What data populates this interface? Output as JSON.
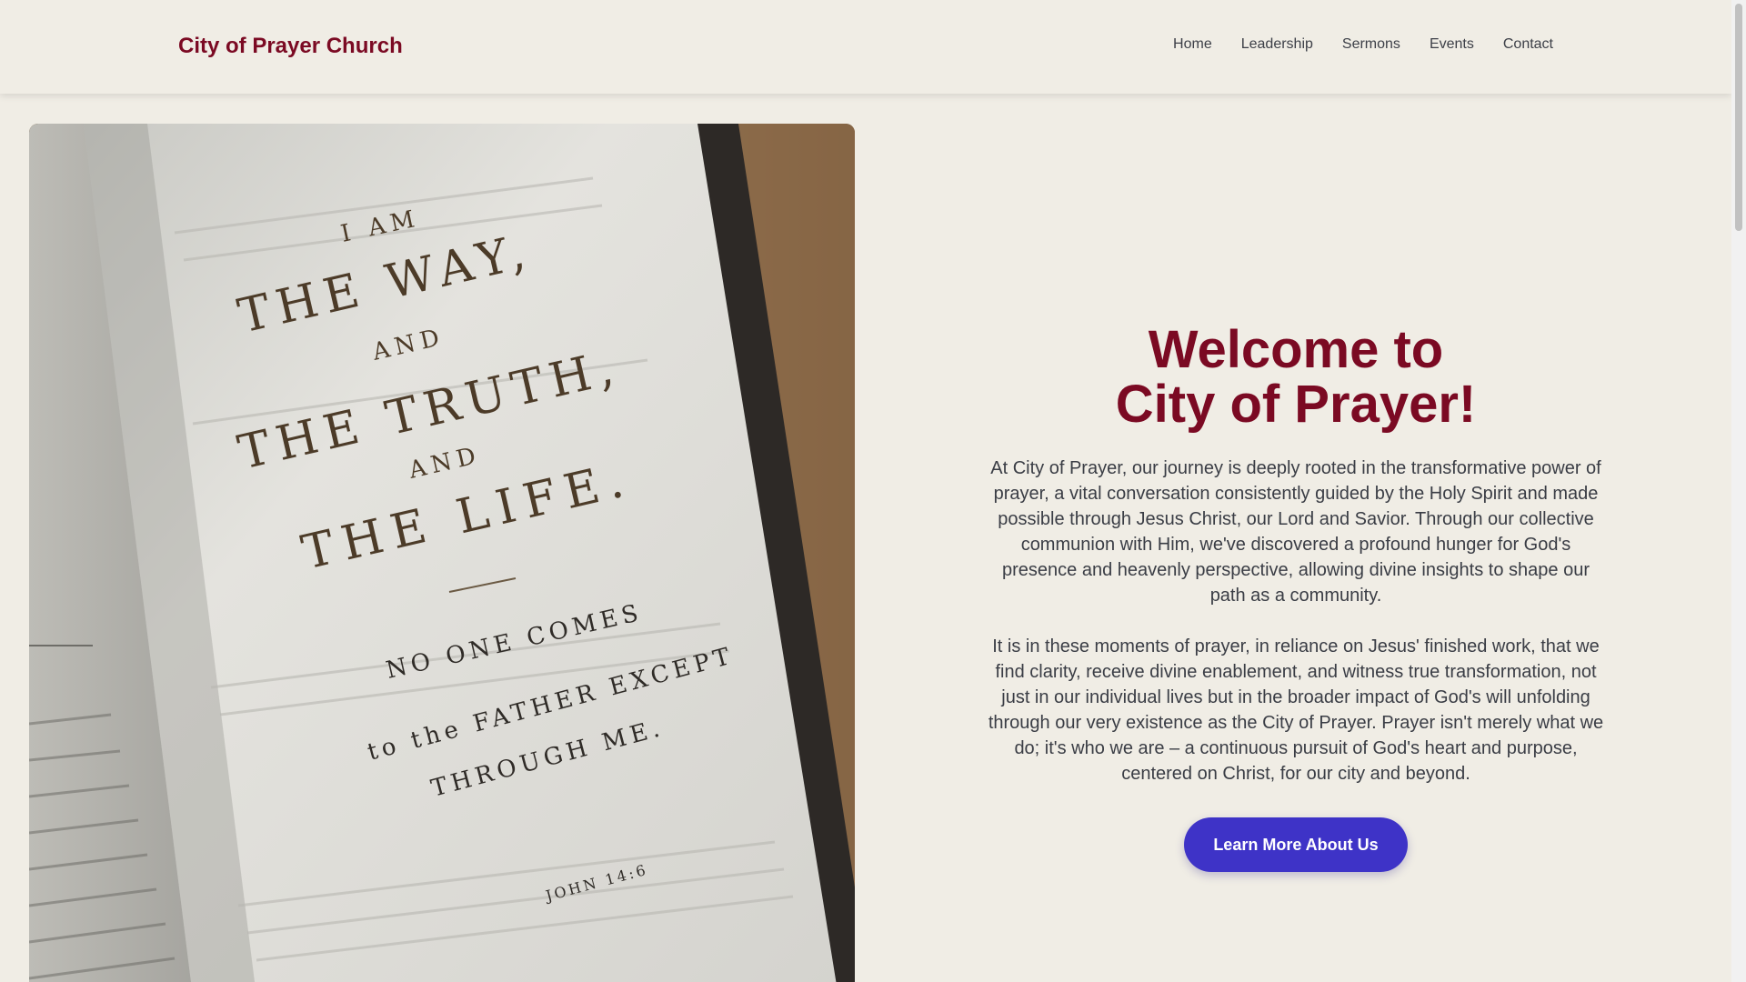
{
  "header": {
    "logo": "City of Prayer Church",
    "nav": [
      "Home",
      "Leadership",
      "Sermons",
      "Events",
      "Contact"
    ]
  },
  "hero_image": {
    "verse": {
      "line1": "I AM",
      "line2": "THE WAY,",
      "line3": "AND",
      "line4": "THE TRUTH,",
      "line5": "AND",
      "line6": "THE LIFE.",
      "line7": "NO ONE COMES",
      "line8": "to the FATHER EXCEPT",
      "line9": "THROUGH ME.",
      "reference": "JOHN 14:6"
    }
  },
  "main": {
    "title_line1": "Welcome to",
    "title_line2": "City of Prayer!",
    "paragraph1": "At City of Prayer, our journey is deeply rooted in the transformative power of prayer, a vital conversation consistently guided by the Holy Spirit and made possible through Jesus Christ, our Lord and Savior. Through our collective communion with Him, we've discovered a profound hunger for God's presence and heavenly perspective, allowing divine insights to shape our path as a community.",
    "paragraph2": "It is in these moments of prayer, in reliance on Jesus' finished work, that we find clarity, receive divine enablement, and witness true transformation, not just in our individual lives but in the broader impact of God's will unfolding through our very existence as the City of Prayer. Prayer isn't merely what we do; it's who we are – a continuous pursuit of God's heart and purpose, centered on Christ, for our city and beyond.",
    "cta_label": "Learn More About Us"
  },
  "colors": {
    "accent": "#7b0a23",
    "button": "#3e33c7",
    "background": "#f0ede5"
  }
}
